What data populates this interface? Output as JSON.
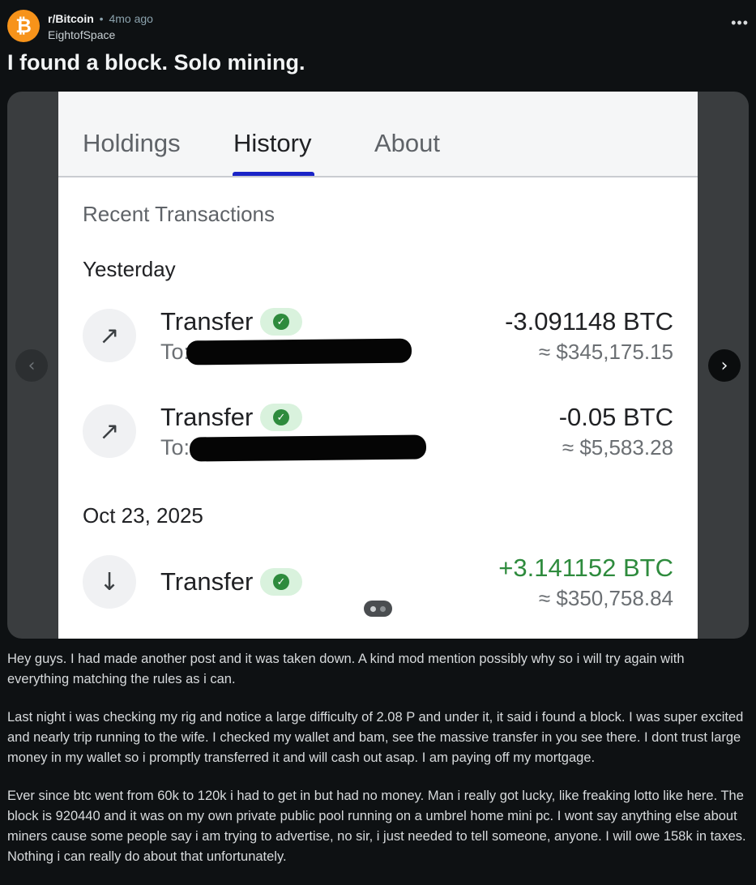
{
  "post": {
    "subreddit": "r/Bitcoin",
    "separator": "•",
    "time_ago": "4mo ago",
    "author": "EightofSpace",
    "avatar_glyph": "₿",
    "more_icon": "•••",
    "title": "I found a block. Solo mining."
  },
  "screenshot": {
    "tabs": [
      "Holdings",
      "History",
      "About"
    ],
    "active_tab": "History",
    "section_title": "Recent Transactions",
    "groups": [
      {
        "label": "Yesterday",
        "transactions": [
          {
            "icon": "arrow-up-right-icon",
            "glyph": "↗",
            "type": "Transfer",
            "to_label": "To:",
            "amount": "-3.091148 BTC",
            "fiat": "≈ $345,175.15",
            "status": "confirmed"
          },
          {
            "icon": "arrow-up-right-icon",
            "glyph": "↗",
            "type": "Transfer",
            "to_label": "To:",
            "amount": "-0.05 BTC",
            "fiat": "≈ $5,583.28",
            "status": "confirmed"
          }
        ]
      },
      {
        "label": "Oct 23, 2025",
        "transactions": [
          {
            "icon": "arrow-down-icon",
            "glyph": "↓",
            "type": "Transfer",
            "amount": "+3.141152 BTC",
            "fiat": "≈ $350,758.84",
            "status": "confirmed"
          }
        ]
      }
    ],
    "colors": {
      "positive": "#2e8b3d",
      "active_tab_underline": "#1a24c7"
    }
  },
  "gallery": {
    "prev_glyph": "‹",
    "next_glyph": "›",
    "total_images": 2,
    "current_image": 1
  },
  "body_paragraphs": [
    "Hey guys. I had made another post and it was taken down. A kind mod mention possibly why so i will try again with everything matching the rules as i can.",
    "Last night i was checking my rig and notice a large difficulty of 2.08 P and under it, it said i found a block. I was super excited and nearly trip running to the wife. I checked my wallet and bam, see the massive transfer in you see there. I dont trust large money in my wallet so i promptly transferred it and will cash out asap. I am paying off my mortgage.",
    "Ever since btc went from 60k to 120k i had to get in but had no money. Man i really got lucky, like freaking lotto like here. The block is 920440 and it was on my own private public pool running on a umbrel home mini pc. I wont say anything else about miners cause some people say i am trying to advertise, no sir, i just needed to tell someone, anyone. I will owe 158k in taxes. Nothing i can really do about that unfortunately."
  ]
}
